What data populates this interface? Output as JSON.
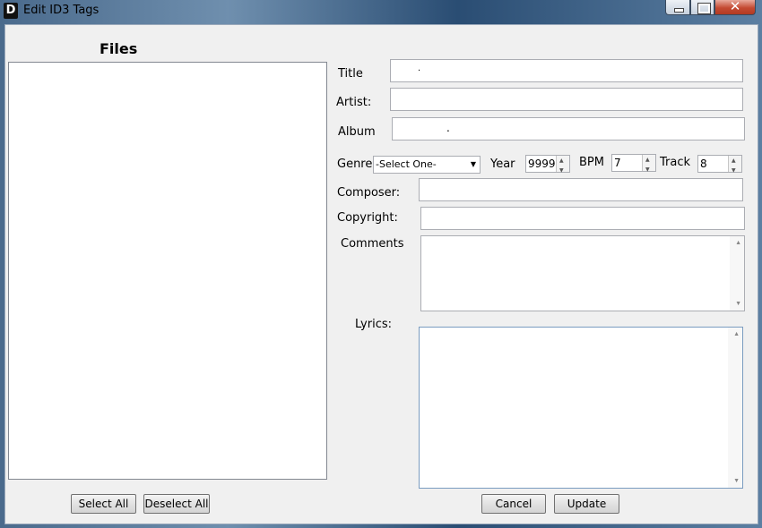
{
  "window": {
    "title": "Edit ID3 Tags",
    "icon": "app-icon",
    "icon_glyph": "D"
  },
  "caption": {
    "close_glyph": "✕"
  },
  "files": {
    "heading": "Files",
    "items": []
  },
  "fields": {
    "title": {
      "label": "Title",
      "value": "."
    },
    "artist": {
      "label": "Artist:",
      "value": ""
    },
    "album": {
      "label": "Album",
      "value": "."
    },
    "genre": {
      "label": "Genre",
      "selected": "-Select One-"
    },
    "year": {
      "label": "Year",
      "value": "9999"
    },
    "bpm": {
      "label": "BPM",
      "value": "7"
    },
    "track": {
      "label": "Track",
      "value": "8"
    },
    "composer": {
      "label": "Composer:",
      "value": ""
    },
    "copyright": {
      "label": "Copyright:",
      "value": ""
    },
    "comments": {
      "label": "Comments",
      "value": ""
    },
    "lyrics": {
      "label": "Lyrics:",
      "value": ""
    }
  },
  "buttons": {
    "select_all": "Select All",
    "deselect_all": "Deselect All",
    "cancel": "Cancel",
    "update": "Update"
  },
  "colors": {
    "titlebar_blue": "#2a4d73",
    "close_red": "#c44a32",
    "face": "#f0f0f0"
  }
}
